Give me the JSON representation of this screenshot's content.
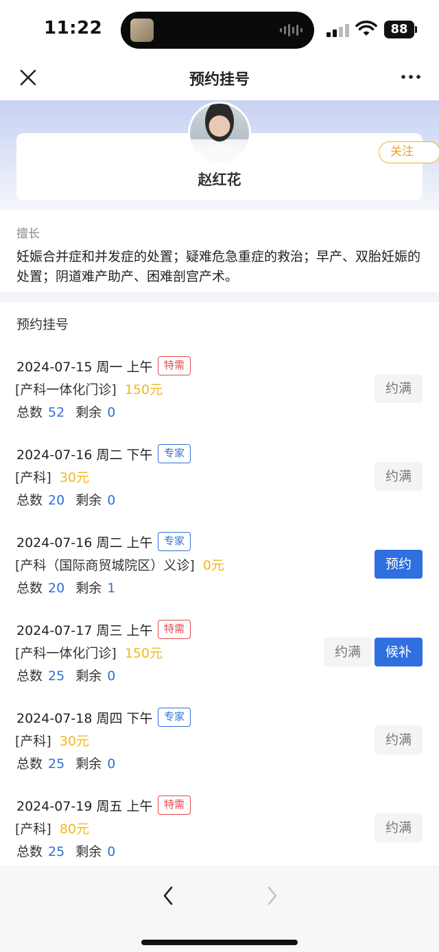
{
  "status_bar": {
    "time": "11:22",
    "battery": "88"
  },
  "nav": {
    "title": "预约挂号"
  },
  "doctor": {
    "name": "赵红花",
    "follow_label": "关注"
  },
  "specialty": {
    "label": "擅长",
    "text": "妊娠合并症和并发症的处置；疑难危急重症的救治；早产、双胎妊娠的处置；阴道难产助产、困难剖宫产术。"
  },
  "schedule": {
    "title": "预约挂号",
    "total_label": "总数",
    "remain_label": "剩余",
    "slots": [
      {
        "date": "2024-07-15 周一 上午",
        "tag": "特需",
        "tag_type": "red",
        "dept": "[产科一体化门诊]",
        "price": "150元",
        "total": "52",
        "remain": "0",
        "buttons": [
          "约满"
        ]
      },
      {
        "date": "2024-07-16 周二 下午",
        "tag": "专家",
        "tag_type": "blue",
        "dept": "[产科]",
        "price": "30元",
        "total": "20",
        "remain": "0",
        "buttons": [
          "约满"
        ]
      },
      {
        "date": "2024-07-16 周二 上午",
        "tag": "专家",
        "tag_type": "blue",
        "dept": "[产科（国际商贸城院区）义诊]",
        "price": "0元",
        "total": "20",
        "remain": "1",
        "buttons": [
          "预约"
        ]
      },
      {
        "date": "2024-07-17 周三 上午",
        "tag": "特需",
        "tag_type": "red",
        "dept": "[产科一体化门诊]",
        "price": "150元",
        "total": "25",
        "remain": "0",
        "buttons": [
          "约满",
          "候补"
        ]
      },
      {
        "date": "2024-07-18 周四 下午",
        "tag": "专家",
        "tag_type": "blue",
        "dept": "[产科]",
        "price": "30元",
        "total": "25",
        "remain": "0",
        "buttons": [
          "约满"
        ]
      },
      {
        "date": "2024-07-19 周五 上午",
        "tag": "特需",
        "tag_type": "red",
        "dept": "[产科]",
        "price": "80元",
        "total": "25",
        "remain": "0",
        "buttons": [
          "约满"
        ]
      }
    ]
  },
  "colors": {
    "primary": "#2f6fe0",
    "price": "#f5b51c",
    "tag_red": "#e5484d",
    "tag_blue": "#2f6fd8"
  }
}
